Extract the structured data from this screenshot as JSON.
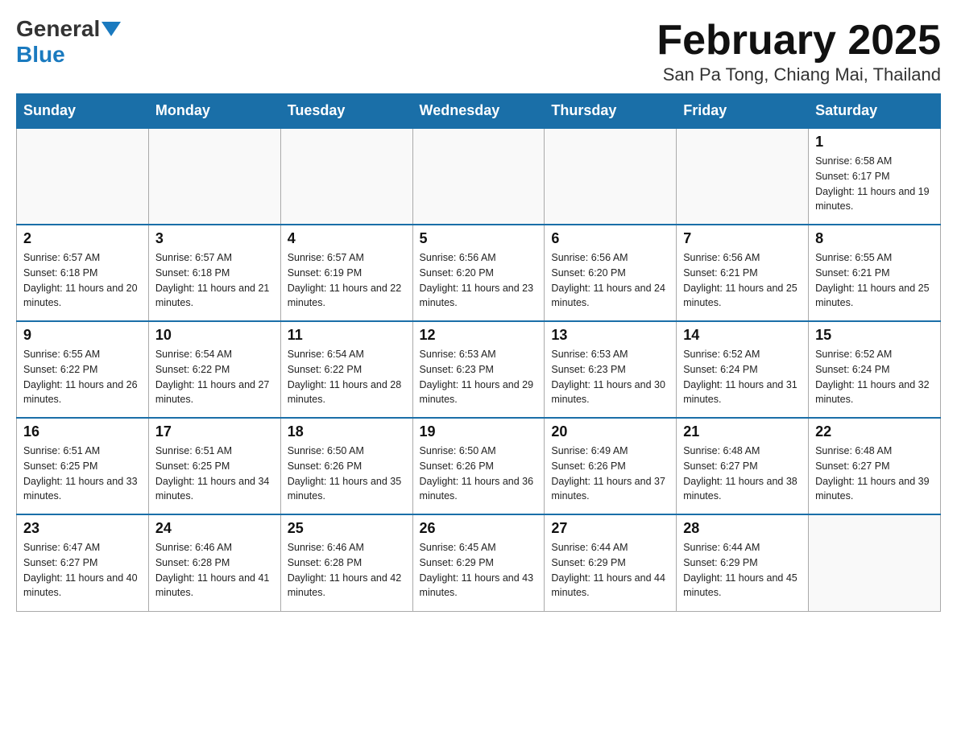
{
  "header": {
    "logo_general": "General",
    "logo_blue": "Blue",
    "month_title": "February 2025",
    "location": "San Pa Tong, Chiang Mai, Thailand"
  },
  "days_of_week": [
    "Sunday",
    "Monday",
    "Tuesday",
    "Wednesday",
    "Thursday",
    "Friday",
    "Saturday"
  ],
  "weeks": [
    [
      {
        "day": "",
        "info": ""
      },
      {
        "day": "",
        "info": ""
      },
      {
        "day": "",
        "info": ""
      },
      {
        "day": "",
        "info": ""
      },
      {
        "day": "",
        "info": ""
      },
      {
        "day": "",
        "info": ""
      },
      {
        "day": "1",
        "info": "Sunrise: 6:58 AM\nSunset: 6:17 PM\nDaylight: 11 hours and 19 minutes."
      }
    ],
    [
      {
        "day": "2",
        "info": "Sunrise: 6:57 AM\nSunset: 6:18 PM\nDaylight: 11 hours and 20 minutes."
      },
      {
        "day": "3",
        "info": "Sunrise: 6:57 AM\nSunset: 6:18 PM\nDaylight: 11 hours and 21 minutes."
      },
      {
        "day": "4",
        "info": "Sunrise: 6:57 AM\nSunset: 6:19 PM\nDaylight: 11 hours and 22 minutes."
      },
      {
        "day": "5",
        "info": "Sunrise: 6:56 AM\nSunset: 6:20 PM\nDaylight: 11 hours and 23 minutes."
      },
      {
        "day": "6",
        "info": "Sunrise: 6:56 AM\nSunset: 6:20 PM\nDaylight: 11 hours and 24 minutes."
      },
      {
        "day": "7",
        "info": "Sunrise: 6:56 AM\nSunset: 6:21 PM\nDaylight: 11 hours and 25 minutes."
      },
      {
        "day": "8",
        "info": "Sunrise: 6:55 AM\nSunset: 6:21 PM\nDaylight: 11 hours and 25 minutes."
      }
    ],
    [
      {
        "day": "9",
        "info": "Sunrise: 6:55 AM\nSunset: 6:22 PM\nDaylight: 11 hours and 26 minutes."
      },
      {
        "day": "10",
        "info": "Sunrise: 6:54 AM\nSunset: 6:22 PM\nDaylight: 11 hours and 27 minutes."
      },
      {
        "day": "11",
        "info": "Sunrise: 6:54 AM\nSunset: 6:22 PM\nDaylight: 11 hours and 28 minutes."
      },
      {
        "day": "12",
        "info": "Sunrise: 6:53 AM\nSunset: 6:23 PM\nDaylight: 11 hours and 29 minutes."
      },
      {
        "day": "13",
        "info": "Sunrise: 6:53 AM\nSunset: 6:23 PM\nDaylight: 11 hours and 30 minutes."
      },
      {
        "day": "14",
        "info": "Sunrise: 6:52 AM\nSunset: 6:24 PM\nDaylight: 11 hours and 31 minutes."
      },
      {
        "day": "15",
        "info": "Sunrise: 6:52 AM\nSunset: 6:24 PM\nDaylight: 11 hours and 32 minutes."
      }
    ],
    [
      {
        "day": "16",
        "info": "Sunrise: 6:51 AM\nSunset: 6:25 PM\nDaylight: 11 hours and 33 minutes."
      },
      {
        "day": "17",
        "info": "Sunrise: 6:51 AM\nSunset: 6:25 PM\nDaylight: 11 hours and 34 minutes."
      },
      {
        "day": "18",
        "info": "Sunrise: 6:50 AM\nSunset: 6:26 PM\nDaylight: 11 hours and 35 minutes."
      },
      {
        "day": "19",
        "info": "Sunrise: 6:50 AM\nSunset: 6:26 PM\nDaylight: 11 hours and 36 minutes."
      },
      {
        "day": "20",
        "info": "Sunrise: 6:49 AM\nSunset: 6:26 PM\nDaylight: 11 hours and 37 minutes."
      },
      {
        "day": "21",
        "info": "Sunrise: 6:48 AM\nSunset: 6:27 PM\nDaylight: 11 hours and 38 minutes."
      },
      {
        "day": "22",
        "info": "Sunrise: 6:48 AM\nSunset: 6:27 PM\nDaylight: 11 hours and 39 minutes."
      }
    ],
    [
      {
        "day": "23",
        "info": "Sunrise: 6:47 AM\nSunset: 6:27 PM\nDaylight: 11 hours and 40 minutes."
      },
      {
        "day": "24",
        "info": "Sunrise: 6:46 AM\nSunset: 6:28 PM\nDaylight: 11 hours and 41 minutes."
      },
      {
        "day": "25",
        "info": "Sunrise: 6:46 AM\nSunset: 6:28 PM\nDaylight: 11 hours and 42 minutes."
      },
      {
        "day": "26",
        "info": "Sunrise: 6:45 AM\nSunset: 6:29 PM\nDaylight: 11 hours and 43 minutes."
      },
      {
        "day": "27",
        "info": "Sunrise: 6:44 AM\nSunset: 6:29 PM\nDaylight: 11 hours and 44 minutes."
      },
      {
        "day": "28",
        "info": "Sunrise: 6:44 AM\nSunset: 6:29 PM\nDaylight: 11 hours and 45 minutes."
      },
      {
        "day": "",
        "info": ""
      }
    ]
  ]
}
